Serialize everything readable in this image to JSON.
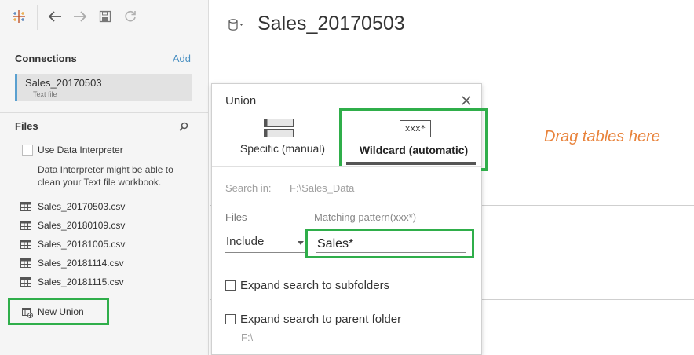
{
  "toolbar": {
    "icons": [
      "tableau-logo-icon",
      "back-arrow-icon",
      "forward-arrow-icon",
      "save-icon",
      "refresh-icon"
    ]
  },
  "connections": {
    "title": "Connections",
    "add_label": "Add",
    "items": [
      {
        "name": "Sales_20170503",
        "type": "Text file"
      }
    ]
  },
  "files": {
    "title": "Files",
    "use_interpreter_label": "Use Data Interpreter",
    "interpreter_desc": "Data Interpreter might be able to clean your Text file workbook.",
    "items": [
      "Sales_20170503.csv",
      "Sales_20180109.csv",
      "Sales_20181005.csv",
      "Sales_20181114.csv",
      "Sales_20181115.csv"
    ],
    "new_union_label": "New Union"
  },
  "main": {
    "datasource_title": "Sales_20170503",
    "drag_hint": "Drag tables here"
  },
  "union_dialog": {
    "title": "Union",
    "tabs": [
      {
        "label": "Specific (manual)",
        "active": false
      },
      {
        "label": "Wildcard (automatic)",
        "active": true,
        "icon_text": "xxx*"
      }
    ],
    "search_in_label": "Search in:",
    "search_in_value": "F:\\Sales_Data",
    "files_label": "Files",
    "files_mode": "Include",
    "pattern_label": "Matching pattern(xxx*)",
    "pattern_value": "Sales*",
    "expand_subfolders_label": "Expand search to subfolders",
    "expand_parent_label": "Expand search to parent folder",
    "parent_path": "F:\\"
  },
  "colors": {
    "highlight_green": "#2fae4a",
    "hint_orange": "#e8823a",
    "link_blue": "#4a90c2"
  }
}
